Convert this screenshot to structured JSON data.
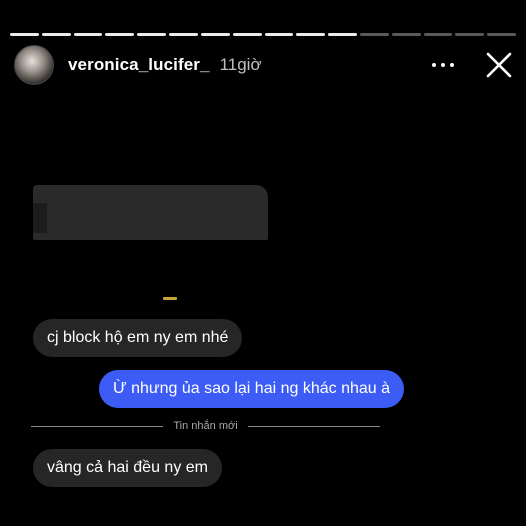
{
  "story": {
    "segments_total": 16,
    "segments_done": 11,
    "username": "veronica_lucifer_",
    "time": "11giờ"
  },
  "icons": {
    "more": "more-horizontal-icon",
    "close": "close-icon"
  },
  "chat": {
    "messages": [
      {
        "side": "in",
        "text": "cj block hộ em ny em nhé"
      },
      {
        "side": "out",
        "text": "Ừ nhưng ủa sao lại hai ng khác nhau à"
      },
      {
        "side": "in",
        "text": "vâng cả hai đều ny em"
      }
    ],
    "divider_label": "Tin nhắn mới"
  },
  "colors": {
    "outgoing_bubble": "#3d5cf5",
    "incoming_bubble": "#262626",
    "background": "#000000"
  }
}
